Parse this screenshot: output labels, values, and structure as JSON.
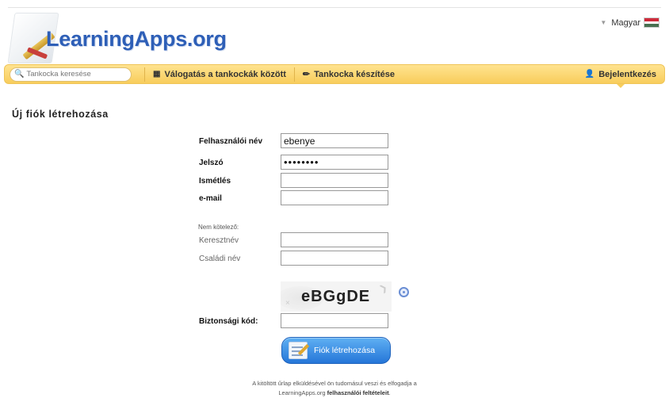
{
  "brand": {
    "name": "LearningApps.org"
  },
  "language": {
    "label": "Magyar",
    "flag_colors": [
      "#ce2939",
      "#ffffff",
      "#477050"
    ]
  },
  "nav": {
    "search_placeholder": "Tankocka keresése",
    "browse_label": "Válogatás a tankockák között",
    "create_label": "Tankocka készítése",
    "login_label": "Bejelentkezés"
  },
  "page": {
    "title": "Új fiók létrehozása"
  },
  "form": {
    "username_label": "Felhasználói név",
    "username_value": "ebenye",
    "password_label": "Jelszó",
    "password_value": "••••••••",
    "repeat_label": "Ismétlés",
    "repeat_value": "",
    "email_label": "e-mail",
    "email_value": "",
    "optional_note": "Nem kötelező:",
    "firstname_label": "Keresztnév",
    "firstname_value": "",
    "lastname_label": "Családi név",
    "lastname_value": "",
    "captcha_text": "eBGgDE",
    "security_label": "Biztonsági kód:",
    "security_value": "",
    "submit_label": "Fiók létrehozása"
  },
  "terms": {
    "line1": "A kitöltött űrlap elküldésével ön tudomásul veszi és elfogadja a",
    "line2_prefix": "LearningApps.org ",
    "line2_link": "felhasználói feltételeit",
    "line2_suffix": "."
  }
}
